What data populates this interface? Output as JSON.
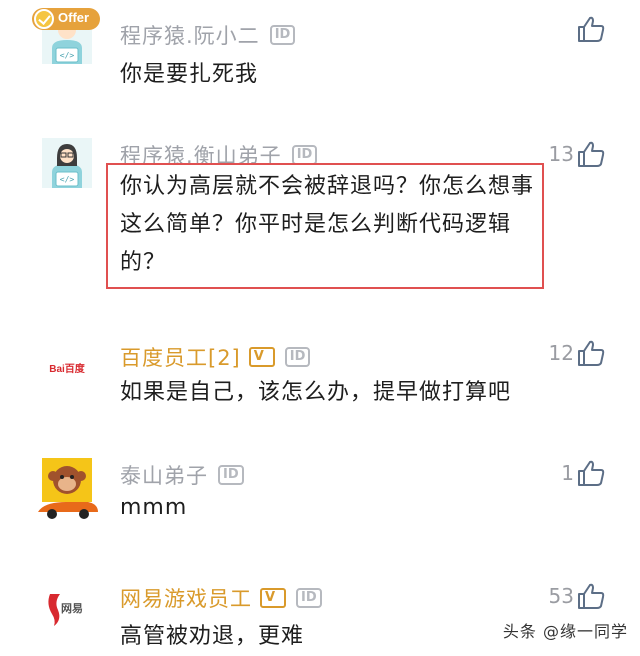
{
  "comments": [
    {
      "username": "程序猿.阮小二",
      "id_badge": "ID",
      "text": "你是要扎死我",
      "likes": "",
      "badge": "Offer",
      "avatar_icon": "programmer-avatar-icon"
    },
    {
      "username": "程序猿.衡山弟子",
      "id_badge": "ID",
      "text": "你认为高层就不会被辞退吗？你怎么想事这么简单？你平时是怎么判断代码逻辑的？",
      "likes": "13",
      "avatar_icon": "programmer-avatar-icon"
    },
    {
      "username": "百度员工[2]",
      "id_badge": "ID",
      "verified": "V",
      "text": "如果是自己，该怎么办，提早做打算吧",
      "likes": "12",
      "avatar_text": "Bai百度",
      "avatar_icon": "baidu-logo-icon"
    },
    {
      "username": "泰山弟子",
      "id_badge": "ID",
      "text": "mmm",
      "likes": "1",
      "avatar_icon": "monkey-car-avatar-icon"
    },
    {
      "username": "网易游戏员工",
      "id_badge": "ID",
      "verified": "V",
      "text": "高管被劝退，更难",
      "likes": "53",
      "avatar_text": "网易",
      "avatar_icon": "netease-logo-icon"
    }
  ],
  "watermark": "头条 @缘一同学",
  "colors": {
    "highlight_border": "#e05050",
    "gold_username": "#d99a2b",
    "gray_username": "#a0a3aa"
  }
}
